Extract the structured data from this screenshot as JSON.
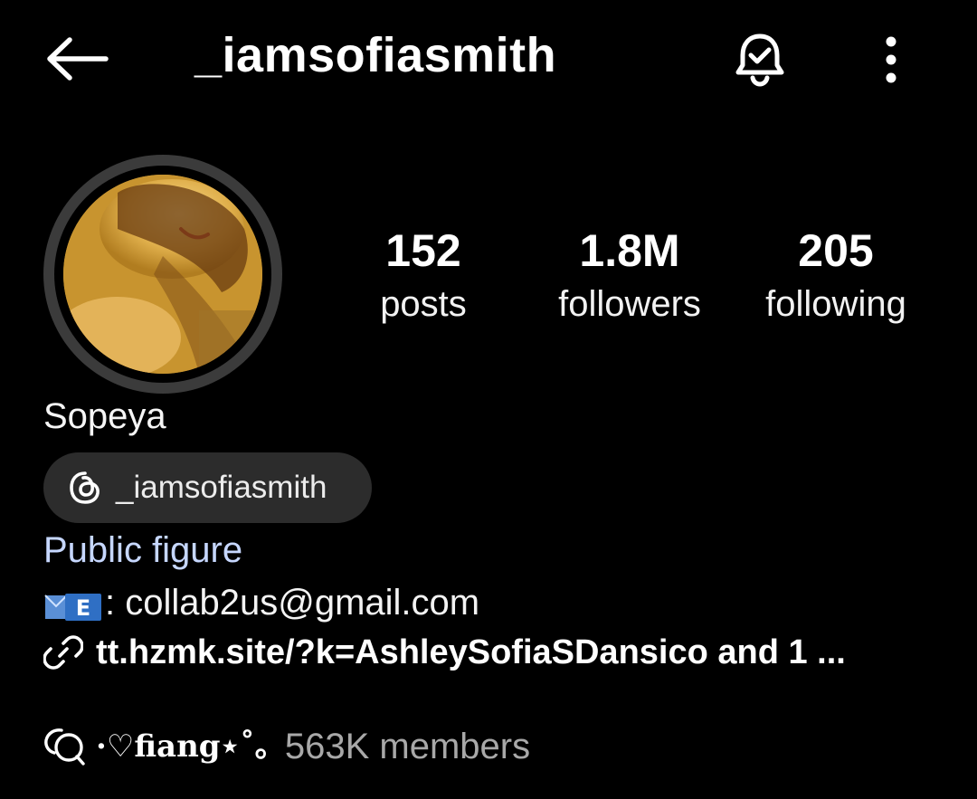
{
  "header": {
    "username": "_iamsofiasmith",
    "back_icon": "arrow-left-icon",
    "bell_icon": "bell-check-icon",
    "menu_icon": "more-vertical-icon"
  },
  "profile": {
    "avatar": "profile-photo",
    "display_name": "Sopeya",
    "threads_handle": "_iamsofiasmith",
    "category": "Public figure",
    "email_prefix": ": collab2us@gmail.com",
    "link": "tt.hzmk.site/?k=AshleySofiaSDansico and 1 ..."
  },
  "stats": [
    {
      "value": "152",
      "label": "posts"
    },
    {
      "value": "1.8M",
      "label": "followers"
    },
    {
      "value": "205",
      "label": "following"
    }
  ],
  "channel": {
    "name": "·♡fiang⋆˚｡",
    "members": "563K members"
  },
  "colors": {
    "background": "#000000",
    "chip": "#2c2c2c",
    "category": "#c6d7ff",
    "muted": "#a8a8a8"
  }
}
